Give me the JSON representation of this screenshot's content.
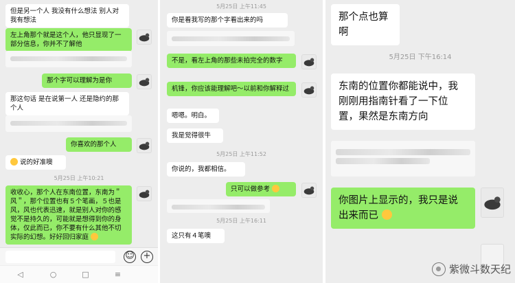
{
  "left": {
    "msgs": {
      "m1": "但是另一个人 我没有什么想法 别人对我有想法",
      "m2": "左上角那个就是这个人，他只显现了一部分信息，你并不了解他",
      "m3": "那个字可以理解为是你",
      "m4": "那这句话  是在说第一人  还是隐约的那个人",
      "m5": "你喜欢的那个人",
      "m6": "说的好准噢",
      "m7": "收收心，那个人在东南位置，东南为＂风＂，那个位置也有５个笔画，５也是风，风也代表迅速，就是别人对你的感觉不是持久的，可能就是想得到你的身体，仅此而已，你不要有什么其他不切实际的幻想。好好回归家庭"
    },
    "timestamps": {
      "t1": "5月25日 上午10:21"
    }
  },
  "middle": {
    "msgs": {
      "m1": "你是看我写的那个字看出来的吗",
      "m2": "不是，看左上角的那些未拍完全的数字",
      "m3": "机锋，你应该能理解吧～以前和你解释过",
      "m4": "嗯嗯。明白。",
      "m5": "我是觉得很牛",
      "m6": "你说的，我都相信。",
      "m7": "只可以做参考",
      "m8": "这只有４笔噢"
    },
    "timestamps": {
      "t1": "5月25日 上午11:45",
      "t2": "5月25日 上午11:46",
      "t3": "5月25日 上午11:52",
      "t4": "5月25日 上午15:45",
      "t5": "5月25日 上午16:11"
    }
  },
  "right": {
    "msgs": {
      "m1": "那个点也算啊",
      "m2": "东南的位置你都能说中，我刚刚用指南针看了一下位置，果然是东南方向",
      "m3": "你图片上显示的，我只是说出来而已"
    },
    "timestamps": {
      "t1": "5月25日 下午16:14"
    }
  },
  "watermark": {
    "text": "紫微斗数天纪"
  },
  "icons": {
    "emoji": "emoji-icon",
    "add": "plus-icon",
    "back": "nav-back-icon",
    "home": "nav-home-icon",
    "recent": "nav-recent-icon",
    "menu": "nav-menu-icon"
  }
}
